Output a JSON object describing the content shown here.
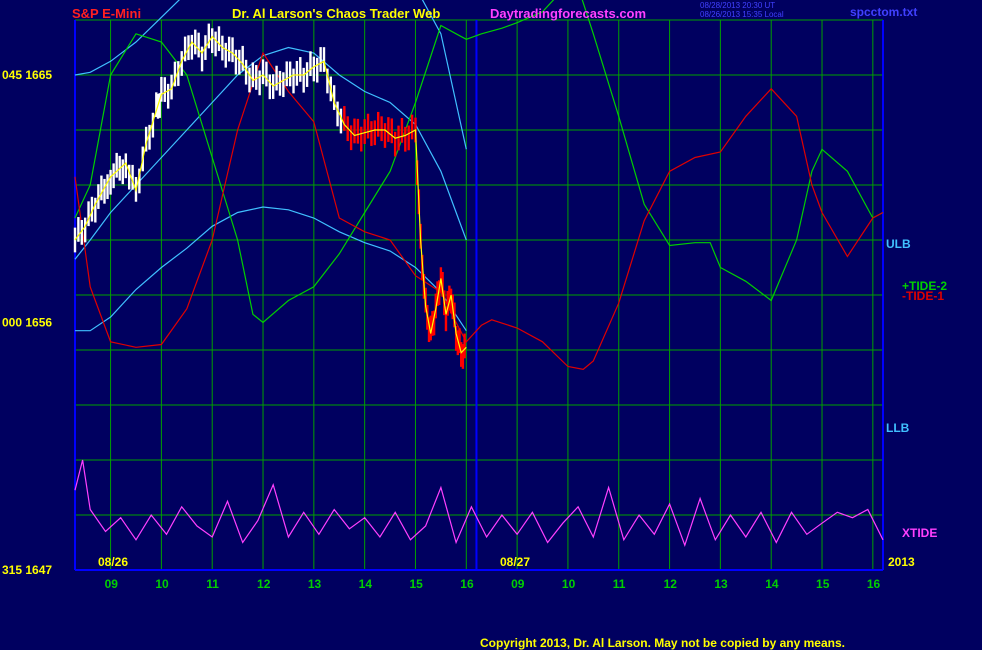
{
  "header": {
    "title_left": "S&P E-Mini",
    "title_center": "Dr. Al Larson's Chaos Trader Web",
    "site": "Daytradingforecasts.com",
    "timestamp_1": "08/28/2013 20:30 UT",
    "timestamp_2": "08/26/2013 15:35 Local",
    "filename": "spcctom.txt"
  },
  "footer": {
    "copyright": "Copyright 2013, Dr. Al Larson. May not be copied by any means."
  },
  "colors": {
    "background": "#000060",
    "grid": "#00a000",
    "axis": "#0000ff",
    "price_up": "#ffffff",
    "price_down": "#ff0000",
    "average": "#ffff00",
    "bands": "#40c0ff",
    "tide2": "#00d000",
    "tide1": "#e00000",
    "xtide": "#ff40ff"
  },
  "chart_data": {
    "type": "line",
    "y_ticks": [
      {
        "label": "045  1665",
        "value": 1665
      },
      {
        "label": "000  1656",
        "value": 1656
      },
      {
        "label": "315  1647",
        "value": 1647
      }
    ],
    "ylim": [
      1647,
      1667
    ],
    "x_ticks": [
      "09",
      "10",
      "11",
      "12",
      "13",
      "14",
      "15",
      "16",
      "09",
      "10",
      "11",
      "12",
      "13",
      "14",
      "15",
      "16"
    ],
    "date_labels": [
      "08/26",
      "08/27",
      "2013"
    ],
    "xlim": [
      8.3,
      24.2
    ],
    "right_labels": {
      "ulb": "ULB",
      "llb": "LLB",
      "tide2": "+TIDE-2",
      "tide1": "-TIDE-1",
      "xtide": "XTIDE"
    },
    "series": [
      {
        "name": "ULB",
        "x": [
          8.3,
          8.6,
          9.0,
          9.5,
          10.0,
          10.5,
          11.0,
          11.5,
          12.0,
          12.5,
          13.0,
          13.5,
          14.0,
          14.5,
          15.0,
          15.5,
          16.0
        ],
        "y": [
          1665.0,
          1665.1,
          1665.5,
          1666.2,
          1667.1,
          1668.0,
          1668.9,
          1669.6,
          1669.9,
          1669.9,
          1669.6,
          1669.2,
          1668.8,
          1668.5,
          1668.2,
          1666.5,
          1662.3
        ]
      },
      {
        "name": "Mid band",
        "x": [
          8.3,
          8.6,
          9.0,
          9.5,
          10.0,
          10.5,
          11.0,
          11.5,
          12.0,
          12.5,
          13.0,
          13.5,
          14.0,
          14.5,
          15.0,
          15.5,
          16.0
        ],
        "y": [
          1658.3,
          1659.0,
          1660.0,
          1661.0,
          1662.0,
          1663.0,
          1664.0,
          1665.0,
          1665.7,
          1666.0,
          1665.8,
          1665.0,
          1664.4,
          1664.0,
          1663.2,
          1661.5,
          1659.0
        ]
      },
      {
        "name": "LLB",
        "x": [
          8.3,
          8.6,
          9.0,
          9.5,
          10.0,
          10.5,
          11.0,
          11.5,
          12.0,
          12.5,
          13.0,
          13.5,
          14.0,
          14.5,
          15.0,
          15.5,
          16.0
        ],
        "y": [
          1655.7,
          1655.7,
          1656.2,
          1657.2,
          1658.0,
          1658.7,
          1659.5,
          1660.0,
          1660.2,
          1660.1,
          1659.8,
          1659.3,
          1658.9,
          1658.6,
          1658.0,
          1657.1,
          1655.7
        ]
      },
      {
        "name": "+TIDE-2",
        "x": [
          8.3,
          8.6,
          9.0,
          9.5,
          10.0,
          10.5,
          11.0,
          11.5,
          11.8,
          12.0,
          12.5,
          13.0,
          13.5,
          14.0,
          14.5,
          15.0,
          15.5,
          15.8,
          16.0,
          16.3,
          16.7,
          17.0,
          17.5,
          18.0,
          18.2,
          18.5,
          19.0,
          19.5,
          20.0,
          20.5,
          20.8,
          21.0,
          21.5,
          22.0,
          22.5,
          22.8,
          23.0,
          23.5,
          24.0,
          24.2
        ],
        "y": [
          1659.8,
          1661.0,
          1665.0,
          1666.5,
          1666.2,
          1665.0,
          1662.0,
          1659.0,
          1656.3,
          1656.0,
          1656.8,
          1657.3,
          1658.5,
          1660.0,
          1661.5,
          1664.0,
          1666.8,
          1666.5,
          1666.3,
          1666.5,
          1666.7,
          1666.9,
          1667.3,
          1668.3,
          1668.2,
          1666.5,
          1663.5,
          1660.3,
          1658.8,
          1658.9,
          1658.9,
          1658.0,
          1657.5,
          1656.8,
          1659.0,
          1661.5,
          1662.3,
          1661.5,
          1659.8,
          1660.0
        ]
      },
      {
        "name": "-TIDE-1",
        "x": [
          8.3,
          8.6,
          9.0,
          9.5,
          10.0,
          10.5,
          11.0,
          11.5,
          12.0,
          12.5,
          13.0,
          13.5,
          14.0,
          14.5,
          15.0,
          15.5,
          15.8,
          16.0,
          16.3,
          16.5,
          17.0,
          17.5,
          18.0,
          18.3,
          18.5,
          19.0,
          19.5,
          20.0,
          20.5,
          21.0,
          21.5,
          22.0,
          22.5,
          22.8,
          23.0,
          23.5,
          24.0,
          24.2
        ],
        "y": [
          1661.3,
          1657.3,
          1655.3,
          1655.1,
          1655.2,
          1656.5,
          1659.0,
          1663.0,
          1665.8,
          1664.4,
          1663.3,
          1659.8,
          1659.3,
          1659.0,
          1657.7,
          1657.1,
          1656.0,
          1655.3,
          1655.9,
          1656.1,
          1655.8,
          1655.3,
          1654.4,
          1654.3,
          1654.6,
          1656.7,
          1659.7,
          1661.5,
          1662.0,
          1662.2,
          1663.5,
          1664.5,
          1663.5,
          1661.0,
          1660.0,
          1658.4,
          1659.8,
          1660.0
        ]
      }
    ],
    "price": {
      "x": [
        8.3,
        8.5,
        8.7,
        9.0,
        9.3,
        9.5,
        9.7,
        9.9,
        10.0,
        10.2,
        10.4,
        10.6,
        10.8,
        11.0,
        11.2,
        11.4,
        11.6,
        11.8,
        12.0,
        12.2,
        12.4,
        12.6,
        12.8,
        13.0,
        13.2,
        13.4,
        13.6,
        13.8,
        14.0,
        14.2,
        14.4,
        14.6,
        14.8,
        15.0,
        15.1,
        15.2,
        15.3,
        15.4,
        15.5,
        15.6,
        15.7,
        15.8,
        15.9,
        16.0
      ],
      "y": [
        1659.0,
        1659.5,
        1660.3,
        1661.3,
        1661.8,
        1660.8,
        1662.5,
        1663.7,
        1664.3,
        1664.5,
        1665.5,
        1666.2,
        1665.8,
        1666.4,
        1666.0,
        1665.8,
        1665.4,
        1664.8,
        1665.0,
        1664.6,
        1664.8,
        1665.0,
        1665.0,
        1665.3,
        1665.5,
        1664.0,
        1663.2,
        1662.8,
        1662.9,
        1663.0,
        1663.0,
        1662.7,
        1662.8,
        1663.0,
        1659.0,
        1656.6,
        1655.6,
        1656.5,
        1657.6,
        1656.3,
        1657.0,
        1655.6,
        1654.9,
        1655.1
      ],
      "down_from_index": 26
    },
    "xtide": {
      "x": [
        8.3,
        8.45,
        8.6,
        8.9,
        9.2,
        9.5,
        9.8,
        10.1,
        10.4,
        10.7,
        11.0,
        11.3,
        11.6,
        11.9,
        12.2,
        12.5,
        12.8,
        13.1,
        13.4,
        13.7,
        14.0,
        14.3,
        14.6,
        14.9,
        15.2,
        15.5,
        15.8,
        16.1,
        16.4,
        16.7,
        17.0,
        17.3,
        17.6,
        17.9,
        18.2,
        18.5,
        18.8,
        19.1,
        19.4,
        19.7,
        20.0,
        20.3,
        20.6,
        20.9,
        21.2,
        21.5,
        21.8,
        22.1,
        22.4,
        22.7,
        23.0,
        23.3,
        23.6,
        23.9,
        24.2
      ],
      "y": [
        1649.9,
        1651.0,
        1649.2,
        1648.4,
        1648.9,
        1648.1,
        1649.0,
        1648.3,
        1649.3,
        1648.6,
        1648.2,
        1649.5,
        1648.0,
        1648.8,
        1650.1,
        1648.2,
        1649.1,
        1648.3,
        1649.2,
        1648.5,
        1648.9,
        1648.2,
        1649.1,
        1648.1,
        1648.6,
        1650.0,
        1648.0,
        1649.3,
        1648.2,
        1649.0,
        1648.3,
        1649.1,
        1648.0,
        1648.7,
        1649.3,
        1648.2,
        1650.0,
        1648.1,
        1649.0,
        1648.3,
        1649.4,
        1647.9,
        1649.6,
        1648.1,
        1649.0,
        1648.2,
        1649.1,
        1648.0,
        1649.1,
        1648.3,
        1648.7,
        1649.1,
        1648.9,
        1649.2,
        1648.1
      ]
    }
  }
}
